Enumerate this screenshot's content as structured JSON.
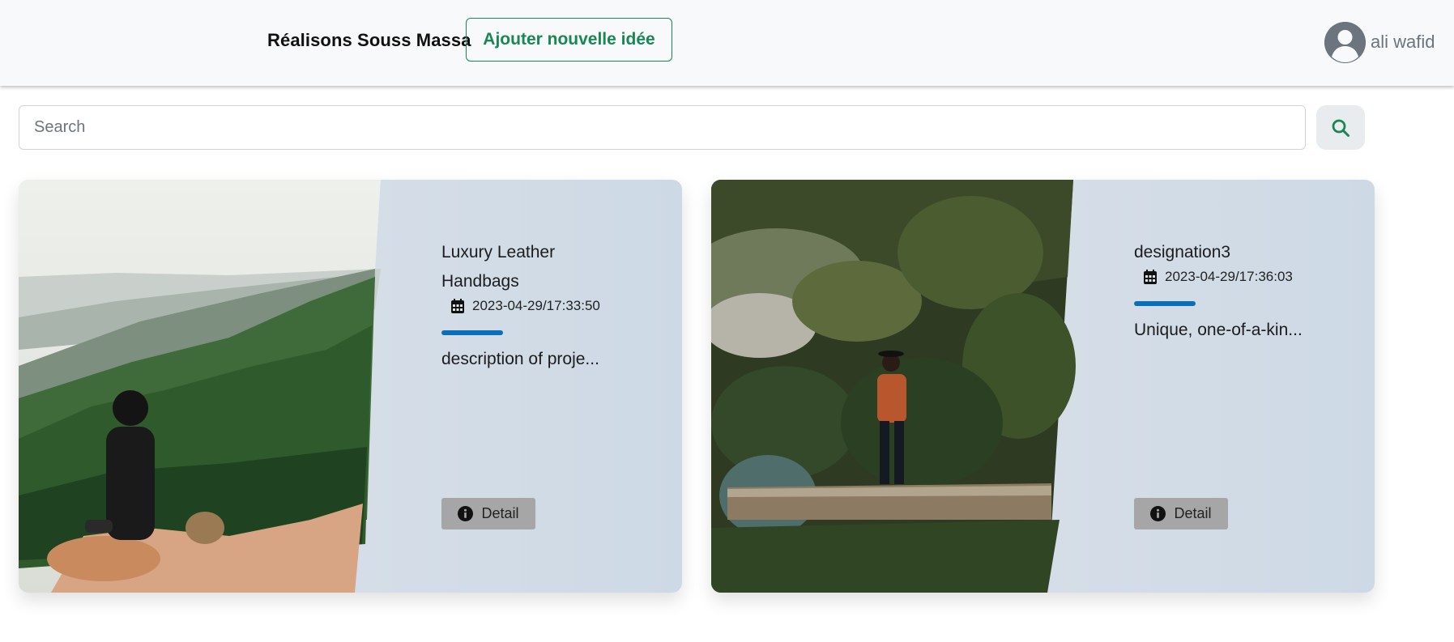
{
  "navbar": {
    "brand": "Réalisons Souss Massa",
    "add_button_label": "Ajouter nouvelle idée",
    "user_name": "ali wafid"
  },
  "search": {
    "placeholder": "Search",
    "value": ""
  },
  "cards": [
    {
      "title": "Luxury Leather Handbags",
      "date": "2023-04-29/17:33:50",
      "description": "description of proje...",
      "detail_label": "Detail"
    },
    {
      "title": "designation3",
      "date": "2023-04-29/17:36:03",
      "description": "Unique, one-of-a-kin...",
      "detail_label": "Detail"
    }
  ],
  "colors": {
    "brand_green": "#198754",
    "accent_blue": "#0a6fb8",
    "navbar_bg": "#f8f9fa",
    "detail_button_bg": "#a6a6a6"
  }
}
